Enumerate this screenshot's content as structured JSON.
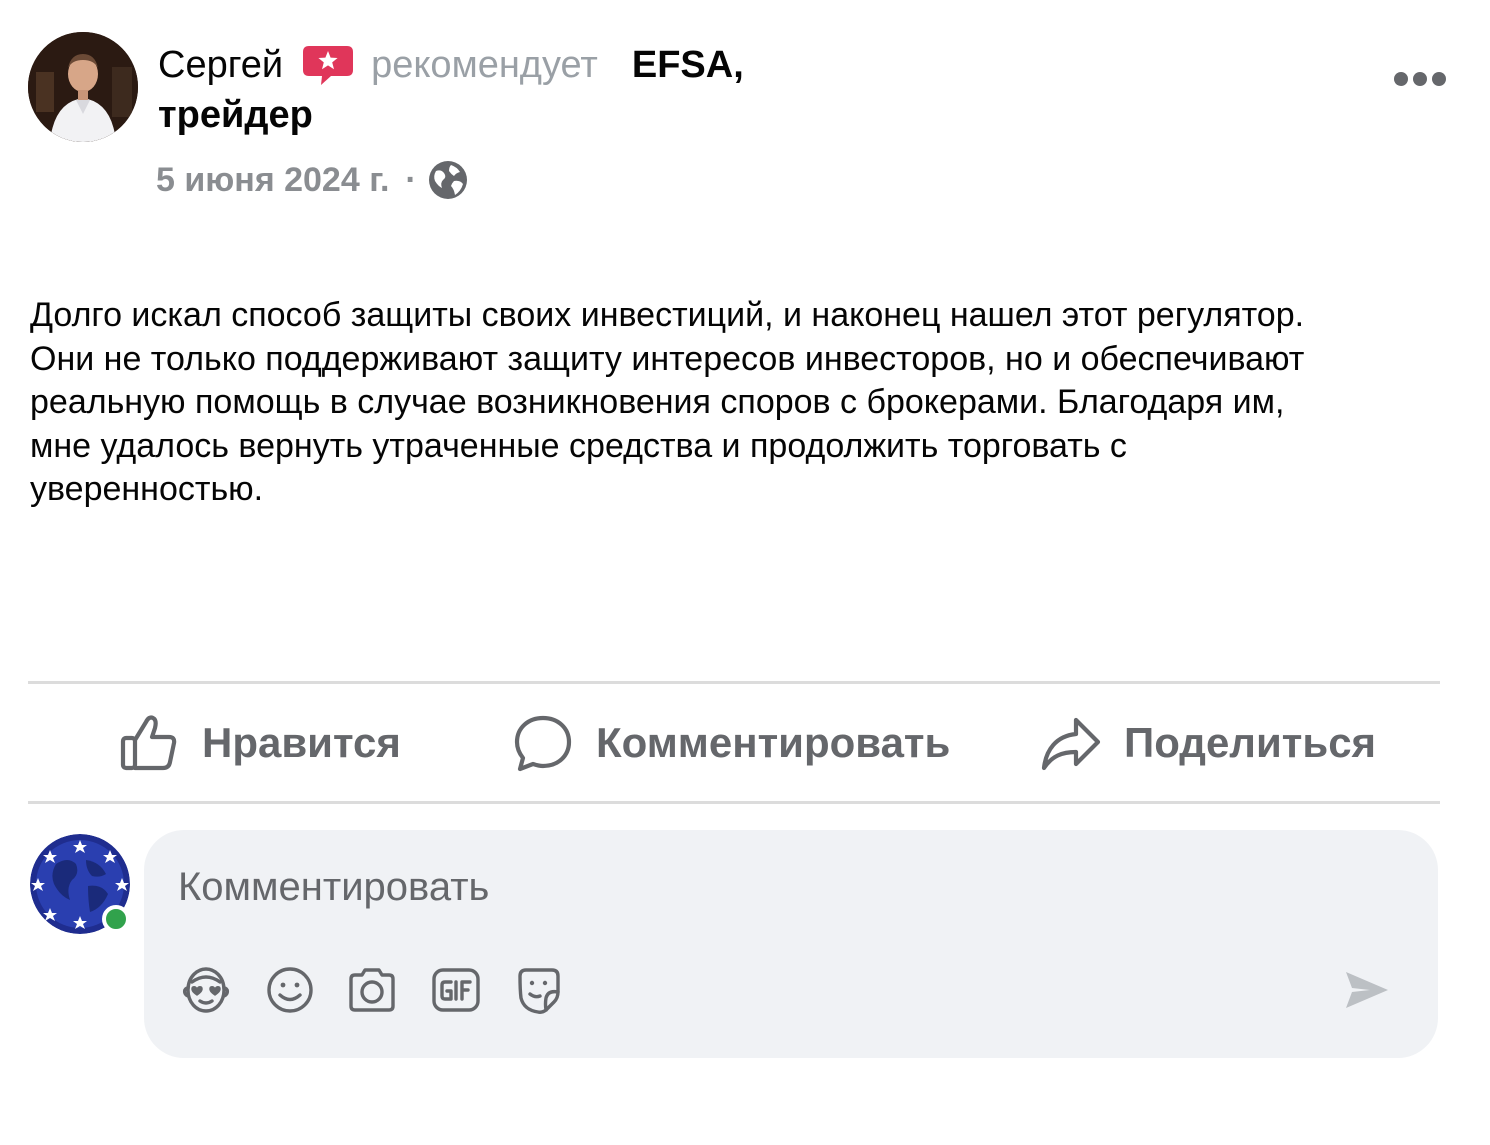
{
  "post": {
    "author_name": "Сергей",
    "recommend_text": "рекомендует",
    "page_name": "EFSA,",
    "page_name_cont": "трейдер",
    "date": "5 июня 2024 г.",
    "separator": "·",
    "privacy_icon": "globe-icon",
    "menu_icon": "more-options-icon",
    "body": "Долго искал способ защиты своих инвестиций, и наконец нашел этот регулятор.\nОни не только поддерживают защиту интересов инвесторов, но и обеспечивают\nреальную помощь в случае возникновения споров с брокерами. Благодаря им,\nмне удалось вернуть утраченные средства и продолжить торговать с\nуверенностью."
  },
  "actions": {
    "like": {
      "label": "Нравится",
      "icon": "thumbs-up-icon"
    },
    "comment": {
      "label": "Комментировать",
      "icon": "comment-bubble-icon"
    },
    "share": {
      "label": "Поделиться",
      "icon": "share-arrow-icon"
    }
  },
  "composer": {
    "placeholder": "Комментировать",
    "tools": [
      "avatar-sticker-icon",
      "emoji-icon",
      "camera-icon",
      "gif-icon",
      "sticker-icon"
    ],
    "send_icon": "send-icon"
  },
  "colors": {
    "text_primary": "#050505",
    "text_secondary": "#65676b",
    "meta_grey": "#8a8d91",
    "badge_red": "#e0365a",
    "composer_bg": "#f0f2f5",
    "online_green": "#31a24c",
    "divider": "#dcdcdc"
  }
}
